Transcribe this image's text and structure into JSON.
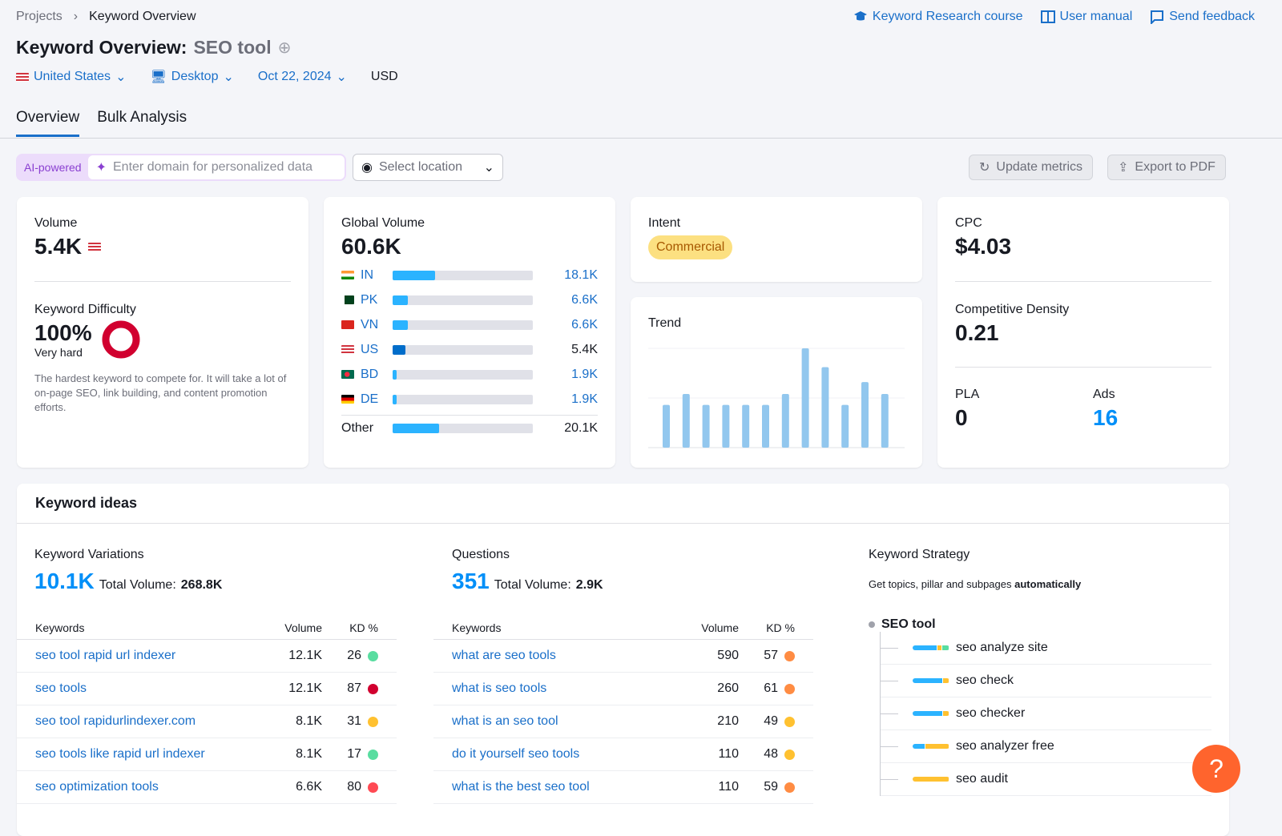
{
  "breadcrumb": {
    "parent": "Projects",
    "current": "Keyword Overview"
  },
  "top_links": [
    {
      "label": "Keyword Research course",
      "icon": "graduation-cap-icon"
    },
    {
      "label": "User manual",
      "icon": "book-icon"
    },
    {
      "label": "Send feedback",
      "icon": "chat-bubble-icon"
    }
  ],
  "title": {
    "prefix": "Keyword Overview:",
    "keyword": "SEO tool"
  },
  "filters": {
    "country": "United States",
    "device": "Desktop",
    "date": "Oct 22, 2024",
    "currency": "USD"
  },
  "tabs": [
    {
      "label": "Overview",
      "active": true
    },
    {
      "label": "Bulk Analysis",
      "active": false
    }
  ],
  "toolbar": {
    "ai_label": "AI-powered",
    "domain_placeholder": "Enter domain for personalized data",
    "location_placeholder": "Select location",
    "update_label": "Update metrics",
    "export_label": "Export to PDF"
  },
  "volume": {
    "label": "Volume",
    "value": "5.4K"
  },
  "difficulty": {
    "label": "Keyword Difficulty",
    "value": "100%",
    "percent": 100,
    "level": "Very hard",
    "description": "The hardest keyword to compete for. It will take a lot of on-page SEO, link building, and content promotion efforts.",
    "color": "#d1002f"
  },
  "global_volume": {
    "label": "Global Volume",
    "value": "60.6K",
    "countries": [
      {
        "code": "IN",
        "value": "18.1K",
        "share": 0.3
      },
      {
        "code": "PK",
        "value": "6.6K",
        "share": 0.11
      },
      {
        "code": "VN",
        "value": "6.6K",
        "share": 0.11
      },
      {
        "code": "US",
        "value": "5.4K",
        "share": 0.09
      },
      {
        "code": "BD",
        "value": "1.9K",
        "share": 0.03
      },
      {
        "code": "DE",
        "value": "1.9K",
        "share": 0.03
      }
    ],
    "other": {
      "label": "Other",
      "value": "20.1K",
      "share": 0.33
    }
  },
  "intent": {
    "label": "Intent",
    "value": "Commercial"
  },
  "trend": {
    "label": "Trend",
    "values": [
      43,
      54,
      43,
      43,
      43,
      43,
      54,
      100,
      81,
      43,
      66,
      54
    ]
  },
  "cpc": {
    "label": "CPC",
    "value": "$4.03"
  },
  "competitive_density": {
    "label": "Competitive Density",
    "value": "0.21"
  },
  "pla": {
    "label": "PLA",
    "value": "0"
  },
  "ads": {
    "label": "Ads",
    "value": "16"
  },
  "keyword_ideas": {
    "title": "Keyword ideas",
    "variations": {
      "label": "Keyword Variations",
      "count": "10.1K",
      "total_label": "Total Volume:",
      "total": "268.8K",
      "headers": [
        "Keywords",
        "Volume",
        "KD %"
      ],
      "rows": [
        {
          "keyword": "seo tool rapid url indexer",
          "volume": "12.1K",
          "kd": "26",
          "color": "#59dda0"
        },
        {
          "keyword": "seo tools",
          "volume": "12.1K",
          "kd": "87",
          "color": "#d1002f"
        },
        {
          "keyword": "seo tool rapidurlindexer.com",
          "volume": "8.1K",
          "kd": "31",
          "color": "#ffc130"
        },
        {
          "keyword": "seo tools like rapid url indexer",
          "volume": "8.1K",
          "kd": "17",
          "color": "#59dda0"
        },
        {
          "keyword": "seo optimization tools",
          "volume": "6.6K",
          "kd": "80",
          "color": "#ff4953"
        }
      ]
    },
    "questions": {
      "label": "Questions",
      "count": "351",
      "total_label": "Total Volume:",
      "total": "2.9K",
      "headers": [
        "Keywords",
        "Volume",
        "KD %"
      ],
      "rows": [
        {
          "keyword": "what are seo tools",
          "volume": "590",
          "kd": "57",
          "color": "#ff8c43"
        },
        {
          "keyword": "what is seo tools",
          "volume": "260",
          "kd": "61",
          "color": "#ff8c43"
        },
        {
          "keyword": "what is an seo tool",
          "volume": "210",
          "kd": "49",
          "color": "#ffc130"
        },
        {
          "keyword": "do it yourself seo tools",
          "volume": "110",
          "kd": "48",
          "color": "#ffc130"
        },
        {
          "keyword": "what is the best seo tool",
          "volume": "110",
          "kd": "59",
          "color": "#ff8c43"
        }
      ]
    },
    "strategy": {
      "label": "Keyword Strategy",
      "subtitle": "Get topics, pillar and subpages",
      "subtitle_bold": "automatically",
      "root": "SEO tool",
      "children": [
        {
          "label": "seo analyze site",
          "segments": [
            [
              "#2bb3ff",
              0.7
            ],
            [
              "#ffc130",
              0.12
            ],
            [
              "#59dda0",
              0.18
            ]
          ]
        },
        {
          "label": "seo check",
          "segments": [
            [
              "#2bb3ff",
              0.85
            ],
            [
              "#ffc130",
              0.15
            ]
          ]
        },
        {
          "label": "seo checker",
          "segments": [
            [
              "#2bb3ff",
              0.85
            ],
            [
              "#ffc130",
              0.15
            ]
          ]
        },
        {
          "label": "seo analyzer free",
          "segments": [
            [
              "#2bb3ff",
              0.35
            ],
            [
              "#ffc130",
              0.65
            ]
          ]
        },
        {
          "label": "seo audit",
          "segments": [
            [
              "#ffc130",
              1
            ]
          ]
        }
      ]
    }
  },
  "help": {
    "label": "?"
  }
}
